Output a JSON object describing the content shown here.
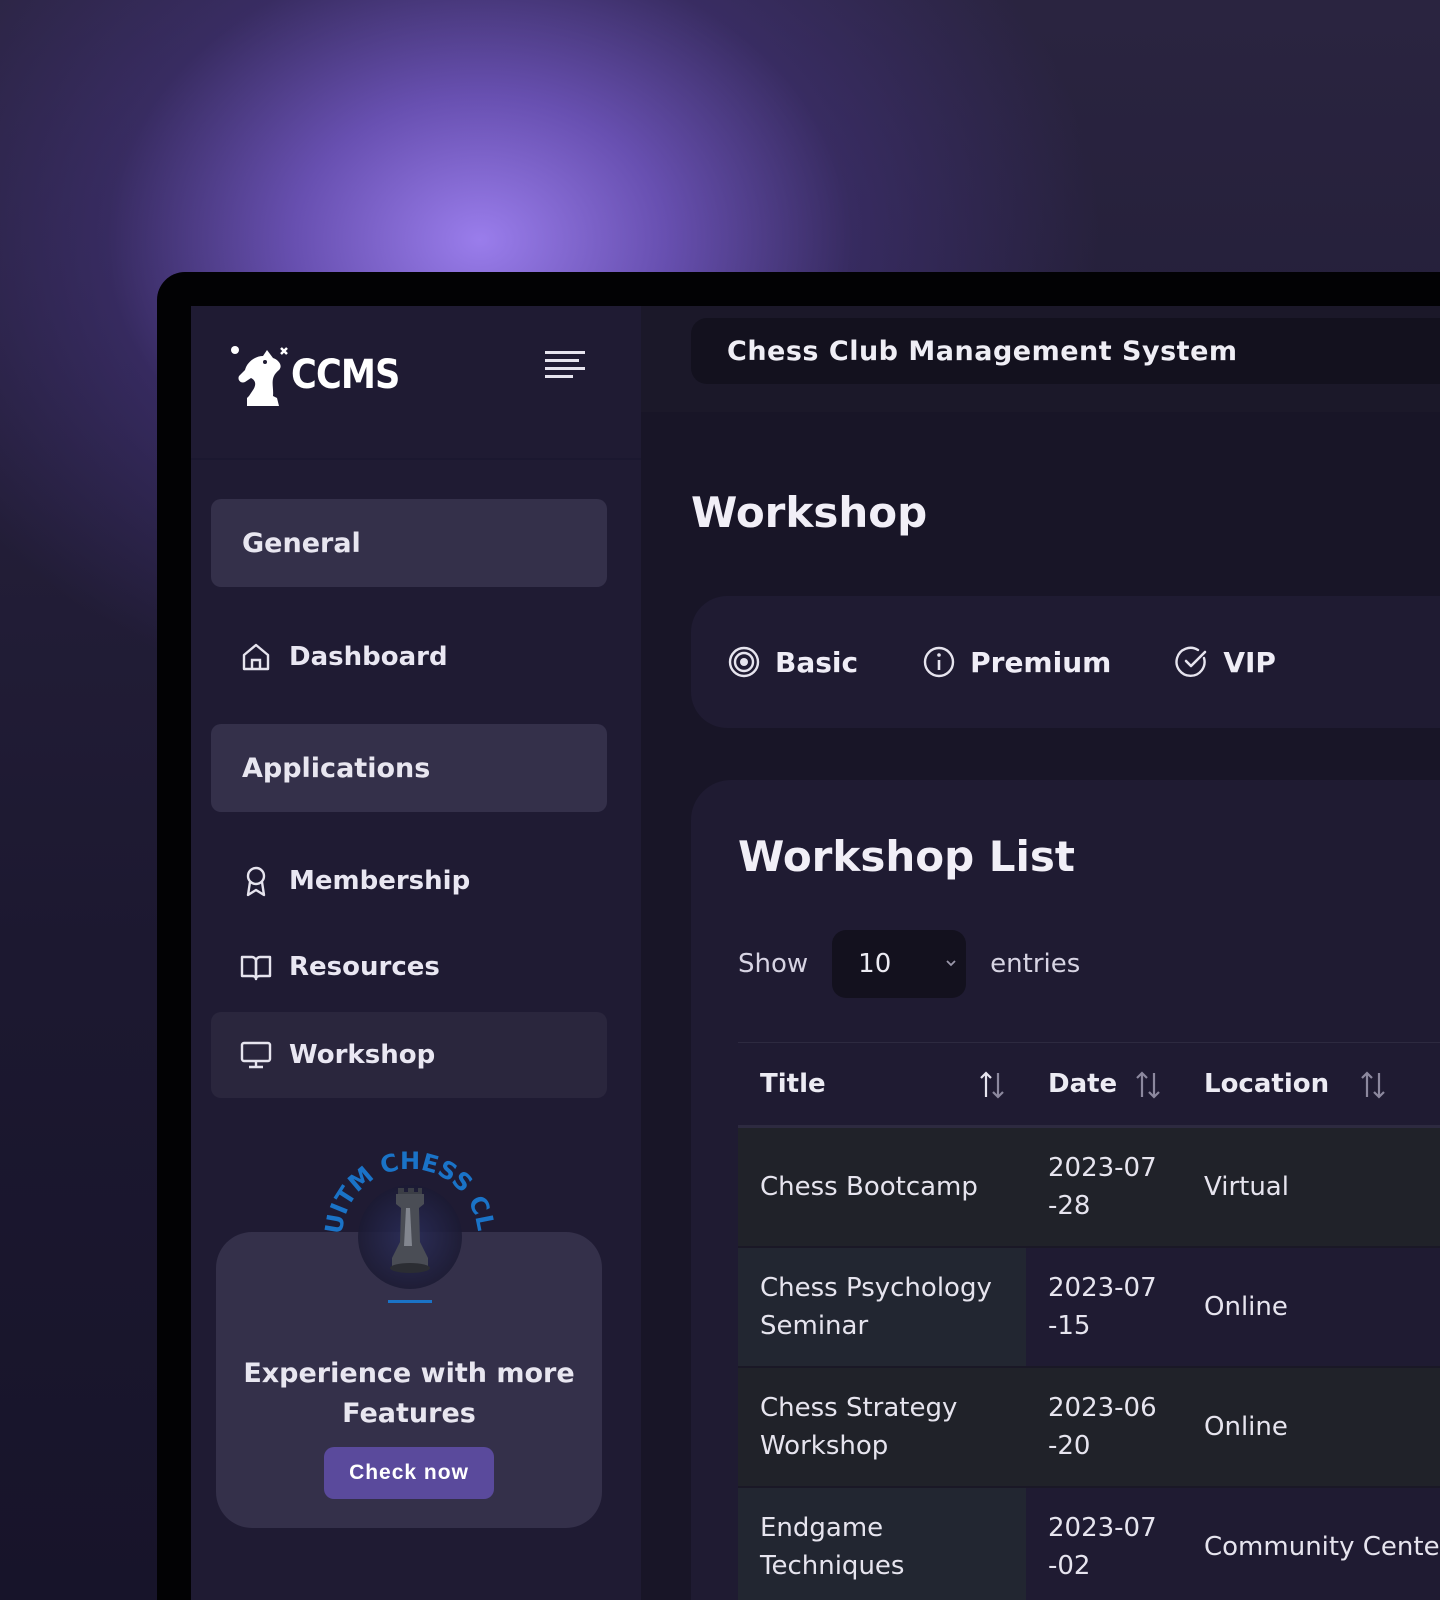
{
  "brand": {
    "name": "CCMS"
  },
  "header": {
    "title": "Chess Club Management System"
  },
  "sidebar": {
    "sections": [
      {
        "label": "General"
      },
      {
        "label": "Applications"
      }
    ],
    "items": [
      {
        "label": "Dashboard",
        "icon": "home-icon"
      },
      {
        "label": "Membership",
        "icon": "award-icon"
      },
      {
        "label": "Resources",
        "icon": "book-open-icon"
      },
      {
        "label": "Workshop",
        "icon": "monitor-icon",
        "active": true
      }
    ],
    "promo": {
      "badge_text": "UITM CHESS CLUB",
      "text": "Experience with more Features",
      "button_label": "Check now"
    }
  },
  "main": {
    "page_title": "Workshop",
    "tabs": [
      {
        "label": "Basic",
        "icon": "target-icon"
      },
      {
        "label": "Premium",
        "icon": "info-icon"
      },
      {
        "label": "VIP",
        "icon": "check-circle-icon"
      }
    ],
    "list": {
      "title": "Workshop List",
      "show_label": "Show",
      "entries_value": "10",
      "entries_label": "entries",
      "columns": [
        "Title",
        "Date",
        "Location"
      ],
      "rows": [
        {
          "title": "Chess Bootcamp",
          "date": "2023-07-28",
          "location": "Virtual"
        },
        {
          "title": "Chess Psychology Seminar",
          "date": "2023-07-15",
          "location": "Online"
        },
        {
          "title": "Chess Strategy Workshop",
          "date": "2023-06-20",
          "location": "Online"
        },
        {
          "title": "Endgame Techniques",
          "date": "2023-07-02",
          "location": "Community Center"
        }
      ]
    }
  },
  "colors": {
    "accent": "#5a4a9c",
    "badge_blue": "#1a73c7",
    "background_glow": "#9b82f0"
  }
}
